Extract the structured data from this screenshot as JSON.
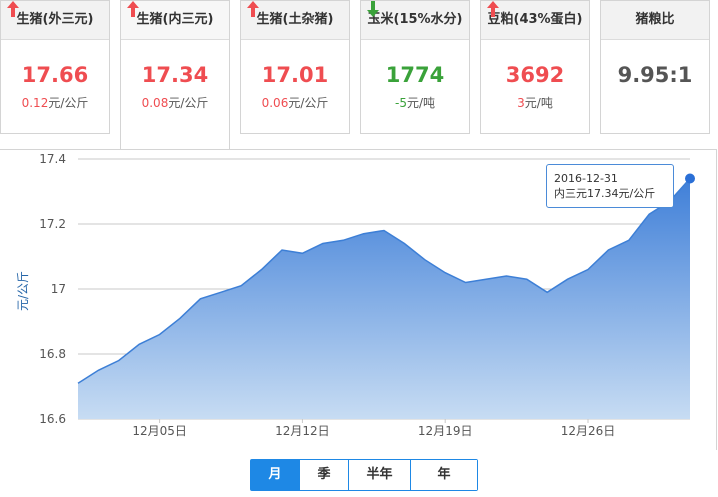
{
  "cards": [
    {
      "title": "生猪(外三元)",
      "price": "17.66",
      "direction": "up",
      "change_value": "0.12",
      "change_unit": "元/公斤"
    },
    {
      "title": "生猪(内三元)",
      "price": "17.34",
      "direction": "up",
      "change_value": "0.08",
      "change_unit": "元/公斤"
    },
    {
      "title": "生猪(土杂猪)",
      "price": "17.01",
      "direction": "up",
      "change_value": "0.06",
      "change_unit": "元/公斤"
    },
    {
      "title": "玉米(15%水分)",
      "price": "1774",
      "direction": "down",
      "change_value": "-5",
      "change_unit": "元/吨"
    },
    {
      "title": "豆粕(43%蛋白)",
      "price": "3692",
      "direction": "up",
      "change_value": "3",
      "change_unit": "元/吨"
    },
    {
      "title": "猪粮比",
      "price": "9.95:1",
      "direction": "none",
      "change_value": "",
      "change_unit": ""
    }
  ],
  "colors": {
    "up": "#ef4d51",
    "down": "#3aa23a",
    "accent": "#1e88e5",
    "line": "#3d7fd6"
  },
  "tooltip": {
    "date": "2016-12-31",
    "series_label": "内三元",
    "value_text": "17.34元/公斤"
  },
  "range_buttons": [
    {
      "label": "月",
      "active": true
    },
    {
      "label": "季",
      "active": false
    },
    {
      "label": "半年",
      "active": false
    },
    {
      "label": "年",
      "active": false
    }
  ],
  "chart_data": {
    "type": "area",
    "ylabel": "元/公斤",
    "ylim": [
      16.6,
      17.4
    ],
    "yticks": [
      "17.4",
      "17.2",
      "17",
      "16.8",
      "16.6"
    ],
    "xtick_labels": [
      "12月05日",
      "12月12日",
      "12月19日",
      "12月26日"
    ],
    "grid": true,
    "series": [
      {
        "x": [
          "2016-12-01",
          "2016-12-02",
          "2016-12-03",
          "2016-12-04",
          "2016-12-05",
          "2016-12-06",
          "2016-12-07",
          "2016-12-08",
          "2016-12-09",
          "2016-12-10",
          "2016-12-11",
          "2016-12-12",
          "2016-12-13",
          "2016-12-14",
          "2016-12-15",
          "2016-12-16",
          "2016-12-17",
          "2016-12-18",
          "2016-12-19",
          "2016-12-20",
          "2016-12-21",
          "2016-12-22",
          "2016-12-23",
          "2016-12-24",
          "2016-12-25",
          "2016-12-26",
          "2016-12-27",
          "2016-12-28",
          "2016-12-29",
          "2016-12-30",
          "2016-12-31"
        ],
        "values": [
          16.71,
          16.75,
          16.78,
          16.83,
          16.86,
          16.91,
          16.97,
          16.99,
          17.01,
          17.06,
          17.12,
          17.11,
          17.14,
          17.15,
          17.17,
          17.18,
          17.14,
          17.09,
          17.05,
          17.02,
          17.03,
          17.04,
          17.03,
          16.99,
          17.03,
          17.06,
          17.12,
          17.15,
          17.23,
          17.27,
          17.34
        ]
      }
    ]
  }
}
